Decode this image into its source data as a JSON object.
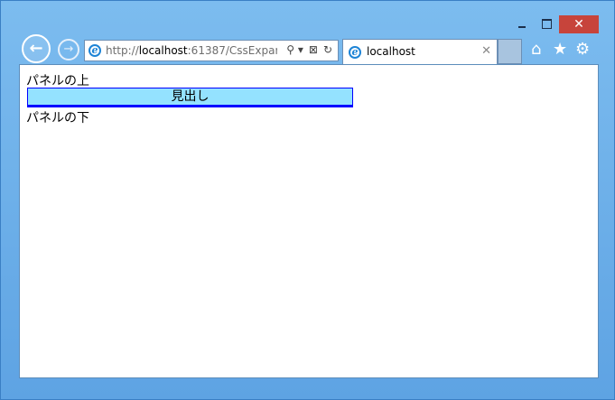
{
  "window": {
    "minimize_glyph": "",
    "close_glyph": "✕"
  },
  "address": {
    "url_prefix": "http://",
    "url_host": "localhost",
    "url_rest": ":61387/CssExpar",
    "icons": [
      "⚲ ▾",
      "⊠",
      "↻"
    ]
  },
  "tab": {
    "title": "localhost",
    "close_glyph": "✕"
  },
  "toolbar": {
    "home_glyph": "⌂",
    "favorites_glyph": "★",
    "settings_glyph": "⚙"
  },
  "page": {
    "text_above": "パネルの上",
    "panel_heading": "見出し",
    "text_below": "パネルの下"
  },
  "colors": {
    "panel_fill": "#94e2ff",
    "panel_border": "#0000ff",
    "close_button": "#c7443b"
  }
}
